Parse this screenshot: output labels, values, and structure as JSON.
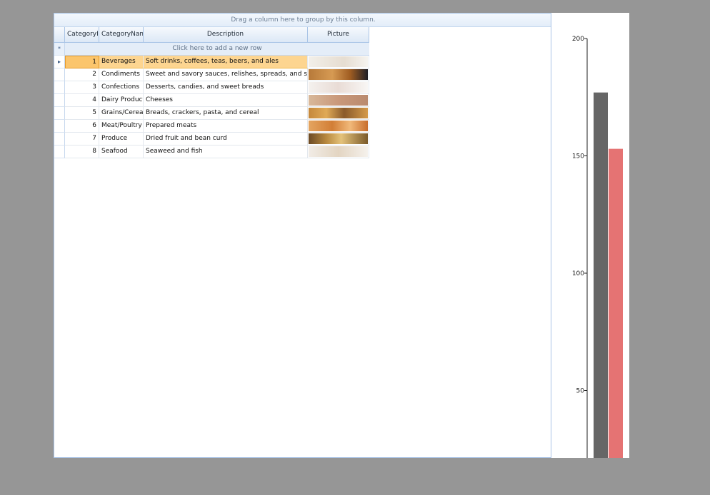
{
  "grid": {
    "group_panel_text": "Drag a column here to group by this column.",
    "columns": [
      "CategoryID",
      "CategoryName",
      "Description",
      "Picture"
    ],
    "new_row_text": "Click here to add a new row",
    "new_row_marker": "*",
    "current_row_marker": "▸",
    "rows": [
      {
        "id": "1",
        "name": "Beverages",
        "description": "Soft drinks, coffees, teas, beers, and ales",
        "picture": "beverages-photo"
      },
      {
        "id": "2",
        "name": "Condiments",
        "description": "Sweet and savory sauces, relishes, spreads, and seasonings",
        "picture": "condiments-photo"
      },
      {
        "id": "3",
        "name": "Confections",
        "description": "Desserts, candies, and sweet breads",
        "picture": "confections-photo"
      },
      {
        "id": "4",
        "name": "Dairy Products",
        "description": "Cheeses",
        "picture": "dairy-photo"
      },
      {
        "id": "5",
        "name": "Grains/Cereals",
        "description": "Breads, crackers, pasta, and cereal",
        "picture": "grains-photo"
      },
      {
        "id": "6",
        "name": "Meat/Poultry",
        "description": "Prepared meats",
        "picture": "meat-photo"
      },
      {
        "id": "7",
        "name": "Produce",
        "description": "Dried fruit and bean curd",
        "picture": "produce-photo"
      },
      {
        "id": "8",
        "name": "Seafood",
        "description": "Seaweed and fish",
        "picture": "seafood-photo"
      }
    ],
    "selected_row": 0
  },
  "chart_data": {
    "type": "bar",
    "y_ticks": [
      "200",
      "150",
      "100",
      "50"
    ],
    "ylim": [
      50,
      200
    ],
    "series": [
      {
        "values": [
          177
        ],
        "color": "#666666"
      },
      {
        "values": [
          153
        ],
        "color": "#e57373"
      }
    ]
  }
}
